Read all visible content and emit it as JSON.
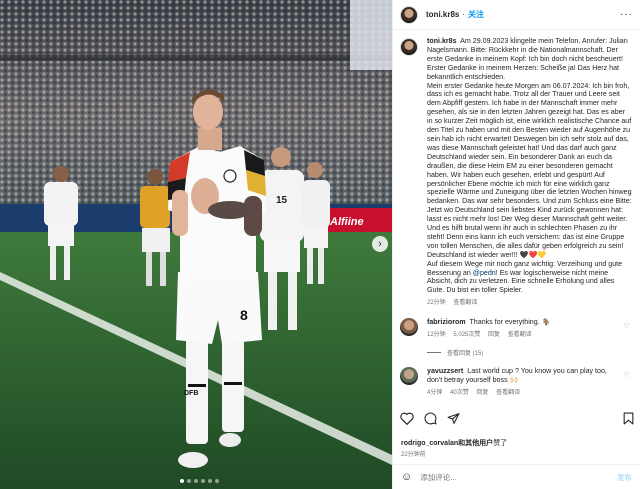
{
  "post": {
    "username": "toni.kr8s",
    "follow_label": "关注",
    "more_label": "···",
    "caption": [
      "Am 29.09.2023 klingelte mein Telefon. Anrufer: Julian Nagelsmann. Bitte: Rückkehr in die Nationalmannschaft. Der erste Gedanke in meinem Kopf: Ich bin doch nicht bescheuert! Erster Gedanke in meinem Herzen: Scheiße ja! Das Herz hat bekanntlich entschieden.",
      "Mein erster Gedanke heute Morgen am 06.07.2024: Ich bin froh, dass ich es gemacht habe. Trotz all der Trauer und Leere seit dem Abpfiff gestern. Ich habe in der Mannschaft immer mehr gesehen, als sie in den letzten Jahren gezeigt hat. Das es aber in so kurzer Zeit möglich ist, eine wirklich realistische Chance auf den Titel zu haben und mit den Besten wieder auf Augenhöhe zu sein hab ich nicht erwartet! Deswegen bin ich sehr stolz auf das, was diese Mannschaft geleistet hat! Und das darf auch ganz Deutschland wieder sein. Ein besonderer Dank an euch da draußen, die diese Heim EM zu einer besonderen gemacht haben. Wir haben euch gesehen, erlebt und gespürt! Auf persönlicher Ebene möchte ich mich für eine wirklich ganz spezielle Wärme und Zuneigung über die letzten Wochen hinweg bedanken. Das war sehr besonders. Und zum Schluss eine Bitte: Jetzt wo Deutschland sein liebstes Kind zurück gewonnen hat: lasst es nicht mehr los! Der Weg dieser Mannschaft geht weiter. Und es hilft brutal wenn ihr auch in schlechten Phasen zu ihr steht! Denn eins kann ich euch versichern: das ist eine Gruppe von tollen Menschen, die alles dafür geben erfolgreich zu sein! Deutschland ist wieder wer!!! 🖤❤️💛",
      "Auf diesem Wege mir noch ganz wichtig: Verzeihung und gute Besserung an",
      "@pedri",
      "! Es war logischerweise nicht meine Absicht, dich zu verletzen. Eine schnelle Erholung und alles Gute. Du bist ein toller Spieler."
    ],
    "caption_meta": {
      "time": "22分钟",
      "translate": "查看翻译"
    },
    "comments": [
      {
        "username": "fabriziorom",
        "text": "Thanks for everything. 🐐",
        "time": "12分钟",
        "likes": "5,025次赞",
        "reply": "回复",
        "translate": "查看翻译",
        "view_replies": "查看回复 (15)",
        "avatar_color": "#7a5c44"
      },
      {
        "username": "yavuzzsert",
        "text": "Last world cup ? You know you can play too, don't betray yourself boss 🙌🏻",
        "time": "4分钟",
        "likes": "40次赞",
        "reply": "回复",
        "translate": "查看翻译",
        "avatar_color": "#5b6b58"
      }
    ],
    "likes_text": "rodrigo_corvalan和其他用户",
    "likes_suffix": "赞了",
    "time_ago": "22分钟前",
    "comment_placeholder": "添加评论...",
    "post_label": "发布"
  },
  "photo": {
    "jersey_number": "8",
    "shorts_number": "8",
    "sock_text": "DFB",
    "player2_number": "15",
    "banner_text": "Alfiine",
    "carousel_dots": 6,
    "active_dot": 0
  },
  "icons": {
    "heart": "heart-icon",
    "comment": "comment-icon",
    "share": "share-icon",
    "save": "bookmark-icon",
    "emoji": "emoji-icon",
    "next": "chevron-right-icon"
  },
  "colors": {
    "accent": "#0095f6",
    "mention": "#00376b",
    "muted": "#737373",
    "post_disabled": "#b2dffc"
  }
}
